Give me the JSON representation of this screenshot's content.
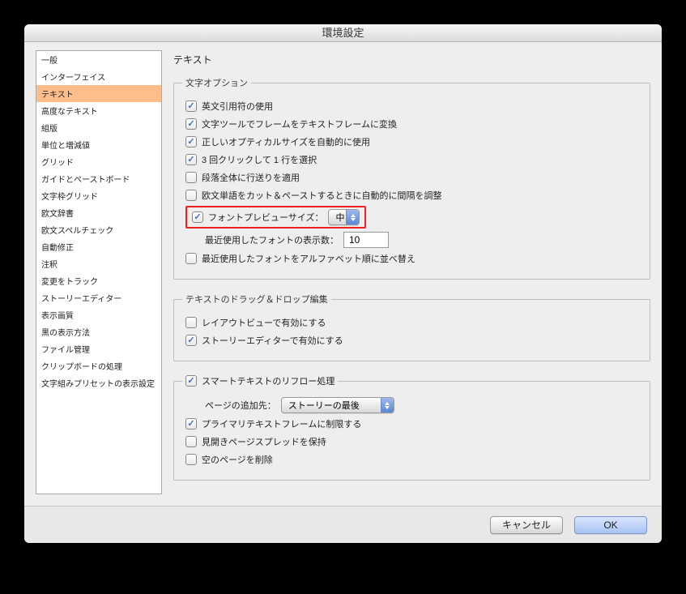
{
  "window": {
    "title": "環境設定"
  },
  "sidebar": {
    "items": [
      "一般",
      "インターフェイス",
      "テキスト",
      "高度なテキスト",
      "組版",
      "単位と増減値",
      "グリッド",
      "ガイドとペーストボード",
      "文字枠グリッド",
      "欧文辞書",
      "欧文スペルチェック",
      "自動修正",
      "注釈",
      "変更をトラック",
      "ストーリーエディター",
      "表示画質",
      "黒の表示方法",
      "ファイル管理",
      "クリップボードの処理",
      "文字組みプリセットの表示設定"
    ],
    "selected_index": 2
  },
  "panel": {
    "title": "テキスト"
  },
  "group_text_options": {
    "legend": "文字オプション",
    "opt_quotes": {
      "checked": true,
      "label": "英文引用符の使用"
    },
    "opt_convert_frame": {
      "checked": true,
      "label": "文字ツールでフレームをテキストフレームに変換"
    },
    "opt_optical_size": {
      "checked": true,
      "label": "正しいオプティカルサイズを自動的に使用"
    },
    "opt_triple_click": {
      "checked": true,
      "label": "3 回クリックして 1 行を選択"
    },
    "opt_leading_paragraph": {
      "checked": false,
      "label": "段落全体に行送りを適用"
    },
    "opt_paste_spacing": {
      "checked": false,
      "label": "欧文単語をカット＆ペーストするときに自動的に間隔を調整"
    },
    "opt_font_preview": {
      "checked": true,
      "label": "フォントプレビューサイズ：",
      "select_value": "中"
    },
    "recent_fonts_label": "最近使用したフォントの表示数：",
    "recent_fonts_value": "10",
    "opt_recent_alpha": {
      "checked": false,
      "label": "最近使用したフォントをアルファベット順に並べ替え"
    }
  },
  "group_drag_drop": {
    "legend": "テキストのドラッグ＆ドロップ編集",
    "opt_layout": {
      "checked": false,
      "label": "レイアウトビューで有効にする"
    },
    "opt_story": {
      "checked": true,
      "label": "ストーリーエディターで有効にする"
    }
  },
  "group_smart_reflow": {
    "legend_checked": true,
    "legend_label": "スマートテキストのリフロー処理",
    "add_pages_label": "ページの追加先：",
    "add_pages_value": "ストーリーの最後",
    "opt_primary_frame": {
      "checked": true,
      "label": "プライマリテキストフレームに制限する"
    },
    "opt_preserve_spreads": {
      "checked": false,
      "label": "見開きページスプレッドを保持"
    },
    "opt_delete_empty": {
      "checked": false,
      "label": "空のページを削除"
    }
  },
  "footer": {
    "cancel": "キャンセル",
    "ok": "OK"
  }
}
